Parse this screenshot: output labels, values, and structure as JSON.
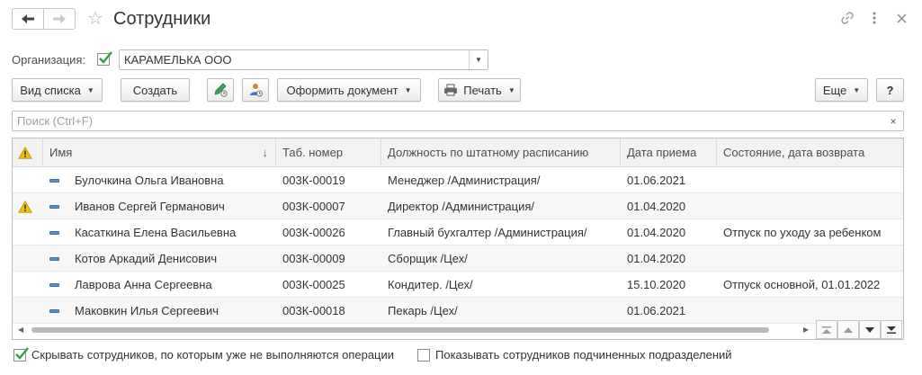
{
  "window": {
    "title": "Сотрудники"
  },
  "filter": {
    "organization_label": "Организация:",
    "organization_checked": true,
    "organization_value": "КАРАМЕЛЬКА ООО"
  },
  "toolbar": {
    "view_list": "Вид списка",
    "create": "Создать",
    "issue_document": "Оформить документ",
    "print": "Печать",
    "more": "Еще",
    "help": "?"
  },
  "search": {
    "placeholder": "Поиск (Ctrl+F)",
    "clear": "×"
  },
  "table": {
    "columns": {
      "name": "Имя",
      "tab_number": "Таб. номер",
      "position": "Должность по штатному расписанию",
      "hire_date": "Дата приема",
      "status": "Состояние, дата возврата"
    },
    "sort_indicator": "↓",
    "rows": [
      {
        "warning": false,
        "name": "Булочкина Ольга Ивановна",
        "tab_number": "003К-00019",
        "position": "Менеджер /Администрация/",
        "hire_date": "01.06.2021",
        "status": ""
      },
      {
        "warning": true,
        "name": "Иванов Сергей Германович",
        "tab_number": "003К-00007",
        "position": "Директор /Администрация/",
        "hire_date": "01.04.2020",
        "status": ""
      },
      {
        "warning": false,
        "name": "Касаткина Елена Васильевна",
        "tab_number": "003К-00026",
        "position": "Главный бухгалтер /Администрация/",
        "hire_date": "01.04.2020",
        "status": "Отпуск по уходу за ребенком"
      },
      {
        "warning": false,
        "name": "Котов Аркадий Денисович",
        "tab_number": "003К-00009",
        "position": "Сборщик /Цех/",
        "hire_date": "01.04.2020",
        "status": ""
      },
      {
        "warning": false,
        "name": "Лаврова Анна Сергеевна",
        "tab_number": "003К-00025",
        "position": "Кондитер. /Цех/",
        "hire_date": "15.10.2020",
        "status": "Отпуск основной, 01.01.2022"
      },
      {
        "warning": false,
        "name": "Маковкин Илья Сергеевич",
        "tab_number": "003К-00018",
        "position": "Пекарь /Цех/",
        "hire_date": "01.06.2021",
        "status": ""
      }
    ]
  },
  "footer": {
    "hide_inactive": "Скрывать сотрудников, по которым уже не выполняются операции",
    "hide_inactive_checked": true,
    "show_subordinate": "Показывать сотрудников подчиненных подразделений",
    "show_subordinate_checked": false
  },
  "colors": {
    "check_green": "#2e9e3e",
    "warning_yellow": "#f2c200",
    "row_marker_blue": "#5a8fc8"
  }
}
